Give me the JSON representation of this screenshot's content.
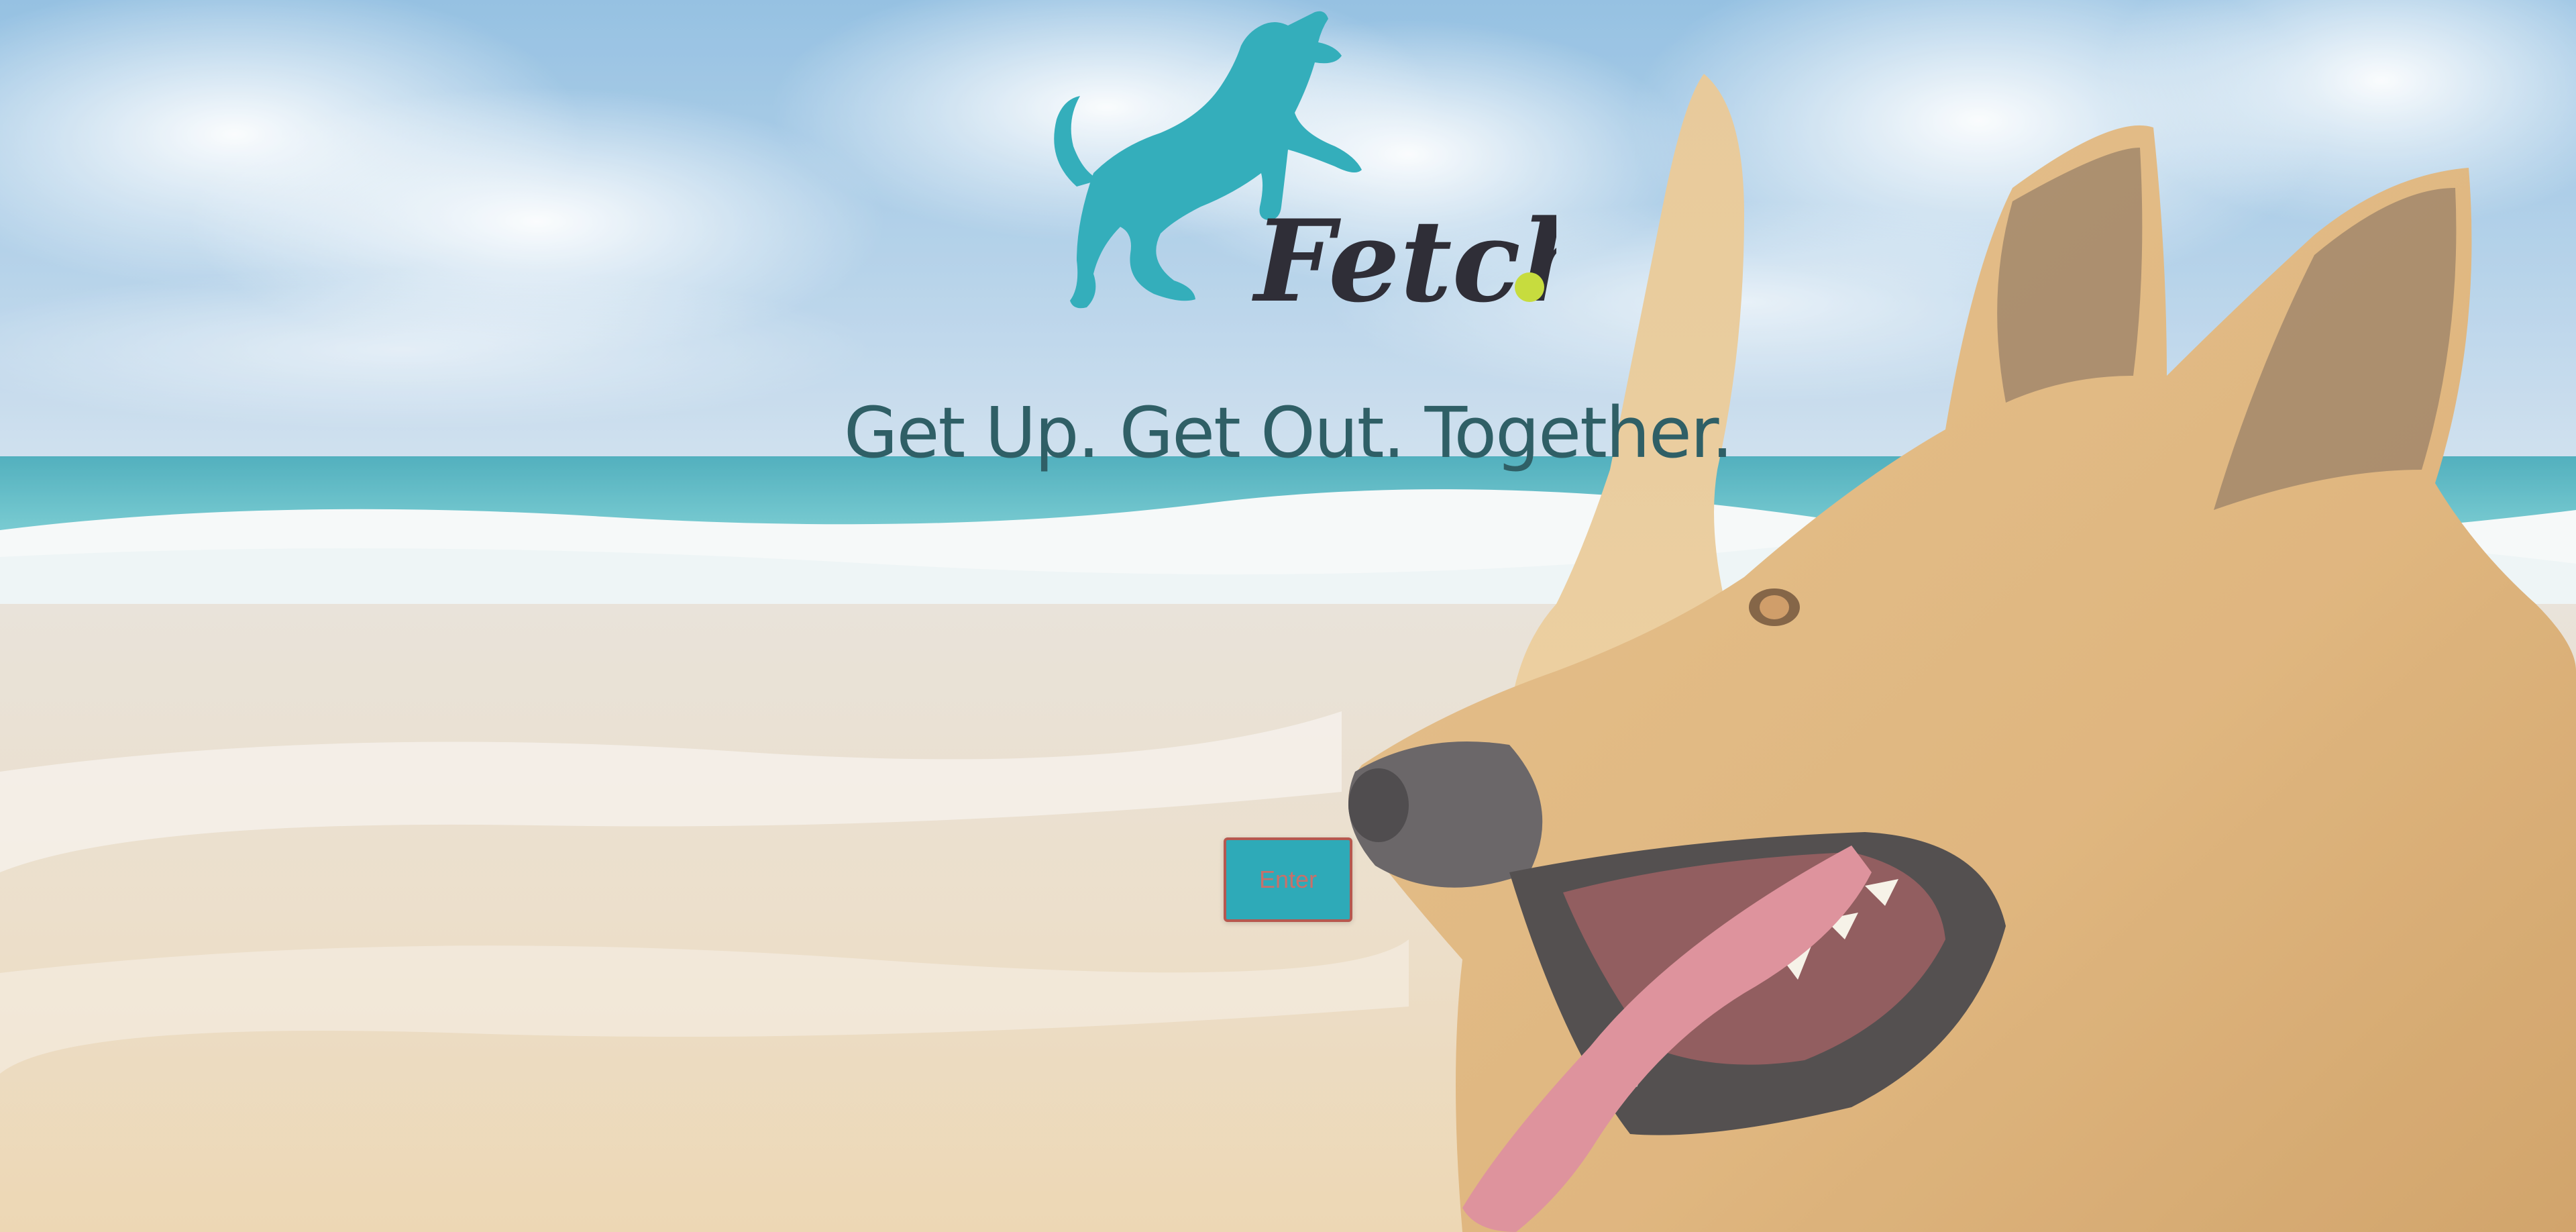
{
  "brand": {
    "name": "Fetch",
    "logo_icon": "dog-jumping-icon",
    "ball_icon": "tennis-ball-icon",
    "primary_color": "#34aebb",
    "text_color": "#2f2e37",
    "ball_color": "#c7dc3e"
  },
  "hero": {
    "tagline": "Get Up. Get Out. Together.",
    "background": "beach-dog-photo"
  },
  "cta": {
    "enter_label": "Enter"
  }
}
